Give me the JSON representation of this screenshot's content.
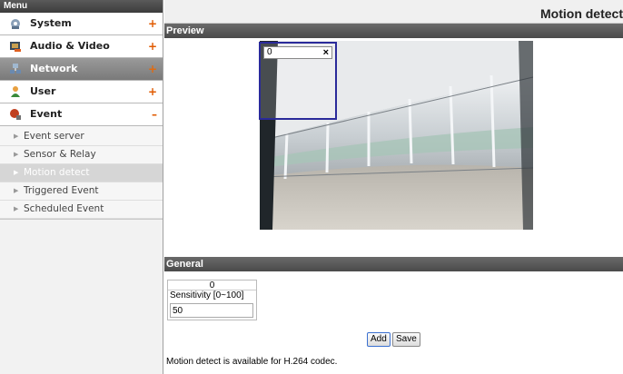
{
  "sidebar": {
    "header": "Menu",
    "items": [
      {
        "label": "System",
        "toggle": "+",
        "icon": "system-gear-icon"
      },
      {
        "label": "Audio & Video",
        "toggle": "+",
        "icon": "audio-video-icon"
      },
      {
        "label": "Network",
        "toggle": "+",
        "icon": "network-icon"
      },
      {
        "label": "User",
        "toggle": "+",
        "icon": "user-icon"
      },
      {
        "label": "Event",
        "toggle": "–",
        "icon": "event-icon"
      }
    ],
    "subitems": [
      {
        "label": "Event server"
      },
      {
        "label": "Sensor & Relay"
      },
      {
        "label": "Motion detect"
      },
      {
        "label": "Triggered Event"
      },
      {
        "label": "Scheduled Event"
      }
    ]
  },
  "main": {
    "title": "Motion detect",
    "preview": {
      "header": "Preview",
      "region_index": "0",
      "region_close": "×"
    },
    "general": {
      "header": "General",
      "region_index": "0",
      "sensitivity_label": "Sensitivity [0~100]",
      "sensitivity_value": "50"
    },
    "buttons": {
      "add": "Add",
      "save": "Save"
    },
    "note": "Motion detect is available for H.264 codec."
  },
  "colors": {
    "accent_toggle": "#e05a00",
    "region_border": "#2a2a9a",
    "section_header": "#555555"
  }
}
